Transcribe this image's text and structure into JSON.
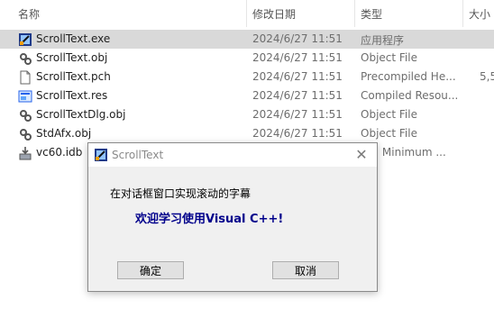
{
  "header": {
    "col_name": "名称",
    "col_date": "修改日期",
    "col_type": "类型",
    "col_size": "大小"
  },
  "files": [
    {
      "name": "ScrollText.exe",
      "date": "2024/6/27 11:51",
      "type": "应用程序",
      "size": "",
      "icon": "exe-app-icon",
      "selected": true
    },
    {
      "name": "ScrollText.obj",
      "date": "2024/6/27 11:51",
      "type": "Object File",
      "size": "",
      "icon": "obj-file-icon"
    },
    {
      "name": "ScrollText.pch",
      "date": "2024/6/27 11:51",
      "type": "Precompiled He...",
      "size": "5,5",
      "icon": "generic-file-icon"
    },
    {
      "name": "ScrollText.res",
      "date": "2024/6/27 11:51",
      "type": "Compiled Resou...",
      "size": "",
      "icon": "resource-file-icon"
    },
    {
      "name": "ScrollTextDlg.obj",
      "date": "2024/6/27 11:51",
      "type": "Object File",
      "size": "",
      "icon": "obj-file-icon"
    },
    {
      "name": "StdAfx.obj",
      "date": "2024/6/27 11:51",
      "type": "Object File",
      "size": "",
      "icon": "obj-file-icon"
    },
    {
      "name": "vc60.idb",
      "date": "",
      "type": "++ Minimum ...",
      "size": "",
      "icon": "idb-file-icon"
    }
  ],
  "dialog": {
    "title": "ScrollText",
    "label": "在对话框窗口实现滚动的字幕",
    "marquee_text": "欢迎学习使用Visual C++!",
    "ok_label": "确定",
    "cancel_label": "取消",
    "marquee_color": "#00008b"
  }
}
